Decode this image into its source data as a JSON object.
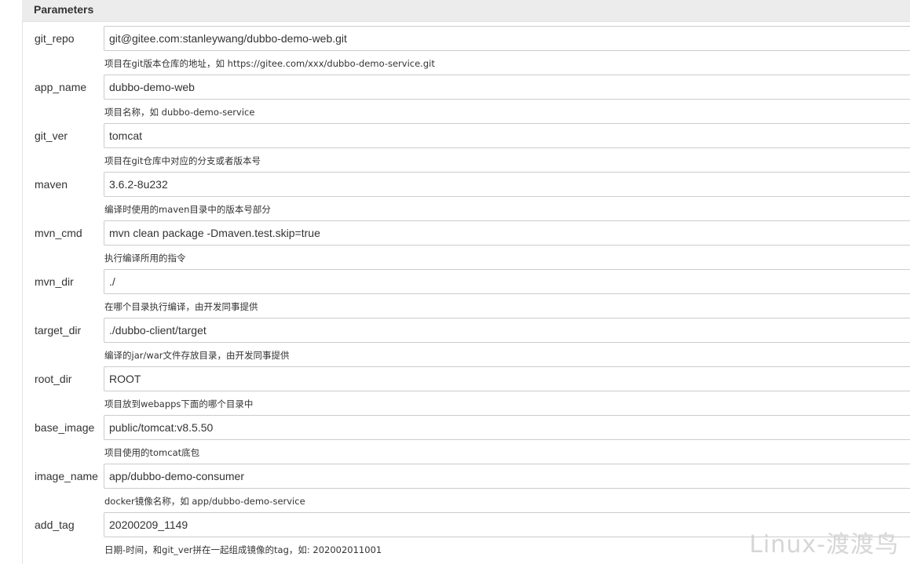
{
  "section": {
    "title": "Parameters"
  },
  "params": [
    {
      "name": "git_repo",
      "value": "git@gitee.com:stanleywang/dubbo-demo-web.git",
      "desc": "项目在git版本仓库的地址，如 https://gitee.com/xxx/dubbo-demo-service.git"
    },
    {
      "name": "app_name",
      "value": "dubbo-demo-web",
      "desc": "项目名称，如 dubbo-demo-service"
    },
    {
      "name": "git_ver",
      "value": "tomcat",
      "desc": "项目在git仓库中对应的分支或者版本号"
    },
    {
      "name": "maven",
      "value": "3.6.2-8u232",
      "desc": "编译时使用的maven目录中的版本号部分"
    },
    {
      "name": "mvn_cmd",
      "value": "mvn clean package -Dmaven.test.skip=true",
      "desc": "执行编译所用的指令"
    },
    {
      "name": "mvn_dir",
      "value": "./",
      "desc": "在哪个目录执行编译，由开发同事提供"
    },
    {
      "name": "target_dir",
      "value": "./dubbo-client/target",
      "desc": "编译的jar/war文件存放目录，由开发同事提供"
    },
    {
      "name": "root_dir",
      "value": "ROOT",
      "desc": "项目放到webapps下面的哪个目录中"
    },
    {
      "name": "base_image",
      "value": "public/tomcat:v8.5.50",
      "desc": "项目使用的tomcat底包"
    },
    {
      "name": "image_name",
      "value": "app/dubbo-demo-consumer",
      "desc": "docker镜像名称，如 app/dubbo-demo-service"
    },
    {
      "name": "add_tag",
      "value": "20200209_1149",
      "desc": "日期-时间，和git_ver拼在一起组成镜像的tag，如: 202002011001"
    }
  ],
  "watermark": "Linux-渡渡鸟"
}
